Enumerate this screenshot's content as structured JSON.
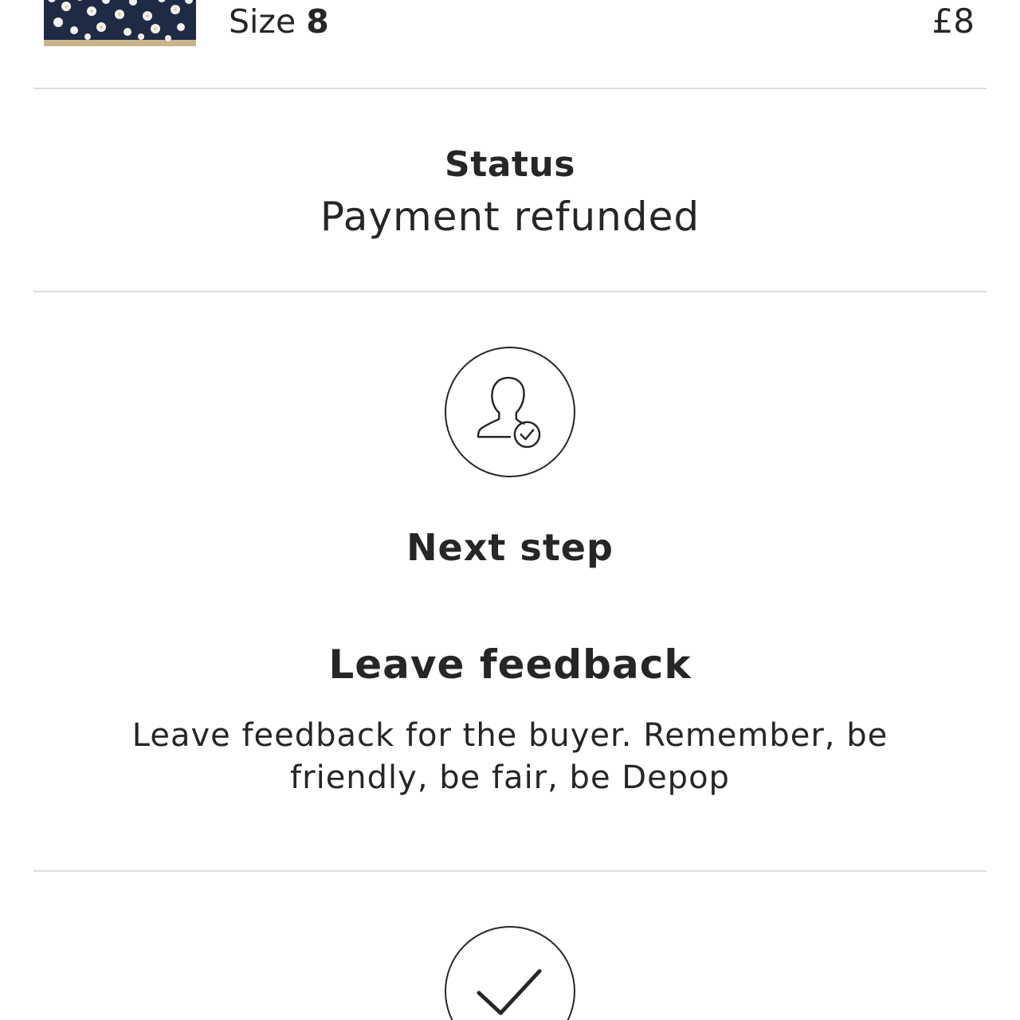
{
  "item": {
    "size_label": "Size",
    "size_value": "8",
    "price": "£8",
    "thumbnail": "floral-print-item-thumbnail"
  },
  "status": {
    "title": "Status",
    "value": "Payment refunded"
  },
  "next_step": {
    "icon": "user-check-icon",
    "heading": "Next step",
    "action_title": "Leave feedback",
    "description": "Leave feedback for the buyer. Remember, be friendly, be fair, be Depop"
  },
  "completed": {
    "icon": "checkmark-icon"
  },
  "colors": {
    "text": "#262626",
    "divider": "#dcdcdc",
    "background": "#ffffff"
  }
}
